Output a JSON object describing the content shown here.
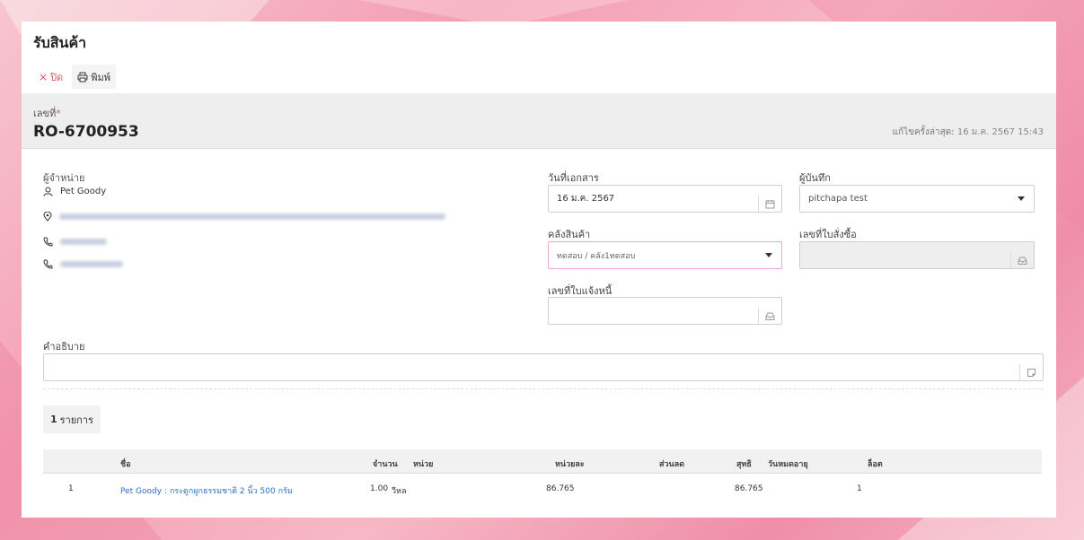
{
  "page": {
    "title": "รับสินค้า"
  },
  "toolbar": {
    "close_label": "ปิด",
    "print_label": "พิมพ์"
  },
  "header": {
    "doc_no_label": "เลขที่",
    "required_mark": "*",
    "doc_no": "RO-6700953",
    "last_edit_label": "แก้ไขครั้งล่าสุด:",
    "last_edit_value": "16 ม.ค. 2567 15:43"
  },
  "vendor": {
    "label": "ผู้จำหน่าย",
    "name": "Pet Goody"
  },
  "form": {
    "doc_date_label": "วันที่เอกสาร",
    "doc_date_value": "16 ม.ค. 2567",
    "recorder_label": "ผู้บันทึก",
    "recorder_value": "pitchapa test",
    "warehouse_label": "คลังสินค้า",
    "warehouse_value": "ทดสอบ / คลัง1ทดสอบ",
    "po_no_label": "เลขที่ใบสั่งซื้อ",
    "po_no_value": "",
    "invoice_no_label": "เลขที่ใบแจ้งหนี้",
    "invoice_no_value": "",
    "description_label": "คำอธิบาย",
    "description_value": ""
  },
  "items": {
    "count": "1",
    "count_unit": "รายการ",
    "columns": {
      "name": "ชื่อ",
      "qty": "จำนวน",
      "unit": "หน่วย",
      "unit_price": "หน่วยละ",
      "discount": "ส่วนลด",
      "net": "สุทธิ",
      "expiry": "วันหมดอายุ",
      "lot": "ล็อต"
    },
    "rows": [
      {
        "no": "1",
        "name": "Pet Goody : กระดูกผูกธรรมชาติ 2 นิ้ว 500 กรัม",
        "qty": "1.00",
        "unit": "วีหล",
        "unit_price": "86.765",
        "discount": "",
        "net": "86.765",
        "expiry": "",
        "lot": "1"
      }
    ]
  },
  "icons": {
    "close": "close-icon",
    "print": "printer-icon",
    "user": "user-icon",
    "location": "location-pin-icon",
    "phone": "phone-icon",
    "calendar": "calendar-icon",
    "inbox": "inbox-icon",
    "note": "note-icon"
  },
  "colors": {
    "accent_red": "#e05a5a",
    "link_blue": "#2f6fc7",
    "highlight_border": "#e8a6d6"
  }
}
